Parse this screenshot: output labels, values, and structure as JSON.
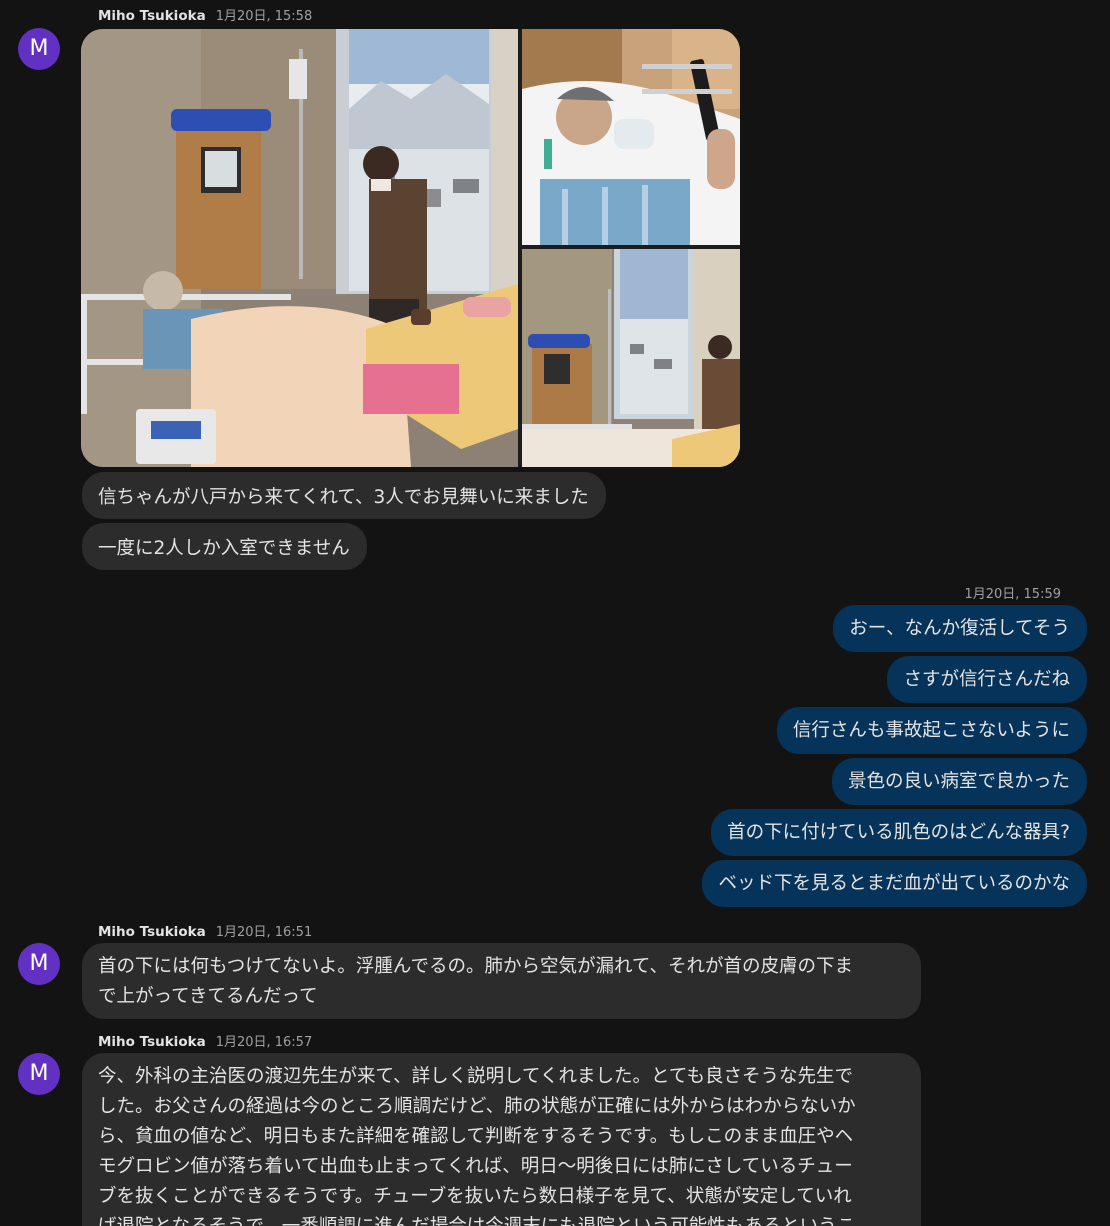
{
  "messages": {
    "m1": {
      "avatar_initial": "M",
      "sender": "Miho Tsukioka",
      "time": "1月20日, 15:58",
      "photos": [
        "hospital-room-photo",
        "patient-with-oxygen-mask-photo",
        "room-window-snow-view-photo"
      ],
      "lines": [
        "信ちゃんが八戸から来てくれて、3人でお見舞いに来ました",
        "一度に2人しか入室できません"
      ]
    },
    "m2": {
      "time": "1月20日, 15:59",
      "lines": [
        "おー、なんか復活してそう",
        "さすが信行さんだね",
        "信行さんも事故起こさないように",
        "景色の良い病室で良かった",
        "首の下に付けている肌色のはどんな器具?",
        "ベッド下を見るとまだ血が出ているのかな"
      ]
    },
    "m3": {
      "avatar_initial": "M",
      "sender": "Miho Tsukioka",
      "time": "1月20日, 16:51",
      "text_line1": "首の下には何もつけてないよ。浮腫んでるの。肺から空気が漏れて、それが首の皮膚の下ま",
      "text_line2": "で上がってきてるんだって"
    },
    "m4": {
      "avatar_initial": "M",
      "sender": "Miho Tsukioka",
      "time": "1月20日, 16:57",
      "lines": [
        "今、外科の主治医の渡辺先生が来て、詳しく説明してくれました。とても良さそうな先生で",
        "した。お父さんの経過は今のところ順調だけど、肺の状態が正確には外からはわからないか",
        "ら、貧血の値など、明日もまた詳細を確認して判断をするそうです。もしこのまま血圧やヘ",
        "モグロビン値が落ち着いて出血も止まってくれば、明日〜明後日には肺にさしているチュー",
        "ブを抜くことができるそうです。チューブを抜いたら数日様子を見て、状態が安定していれ",
        "ば退院となるそうで、一番順調に進んだ場合は今週末にも退院という可能性もあるというこ"
      ]
    }
  },
  "colors": {
    "background": "#131313",
    "incoming_bubble": "#2c2c2c",
    "outgoing_bubble": "#053359",
    "avatar": "#6330c4"
  }
}
